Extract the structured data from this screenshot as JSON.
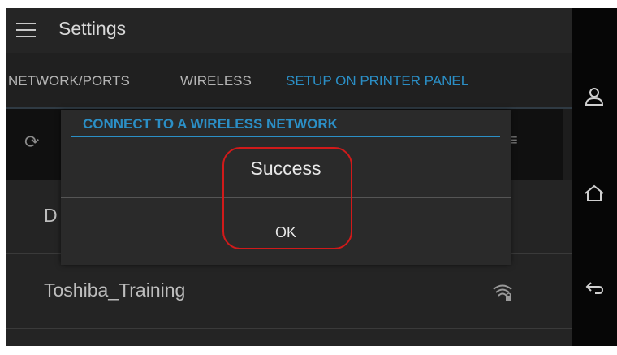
{
  "header": {
    "title": "Settings",
    "menu_icon": "hamburger-menu-icon"
  },
  "tabs": [
    {
      "label": "NETWORK/PORTS",
      "active": false
    },
    {
      "label": "WIRELESS",
      "active": false
    },
    {
      "label": "SETUP ON PRINTER PANEL",
      "active": true
    }
  ],
  "setup_row": {
    "refresh_icon": "refresh-icon"
  },
  "networks": [
    {
      "name": "D",
      "secured": true
    },
    {
      "name": "Toshiba_Training",
      "secured": true
    }
  ],
  "dialog": {
    "title": "CONNECT TO A WIRELESS NETWORK",
    "message": "Success",
    "ok_label": "OK"
  },
  "sidebar": {
    "icons": [
      "user-icon",
      "home-icon",
      "back-icon"
    ]
  },
  "colors": {
    "accent": "#2b8fc6",
    "highlight": "#d11a1a",
    "background": "#1d1d1d"
  }
}
